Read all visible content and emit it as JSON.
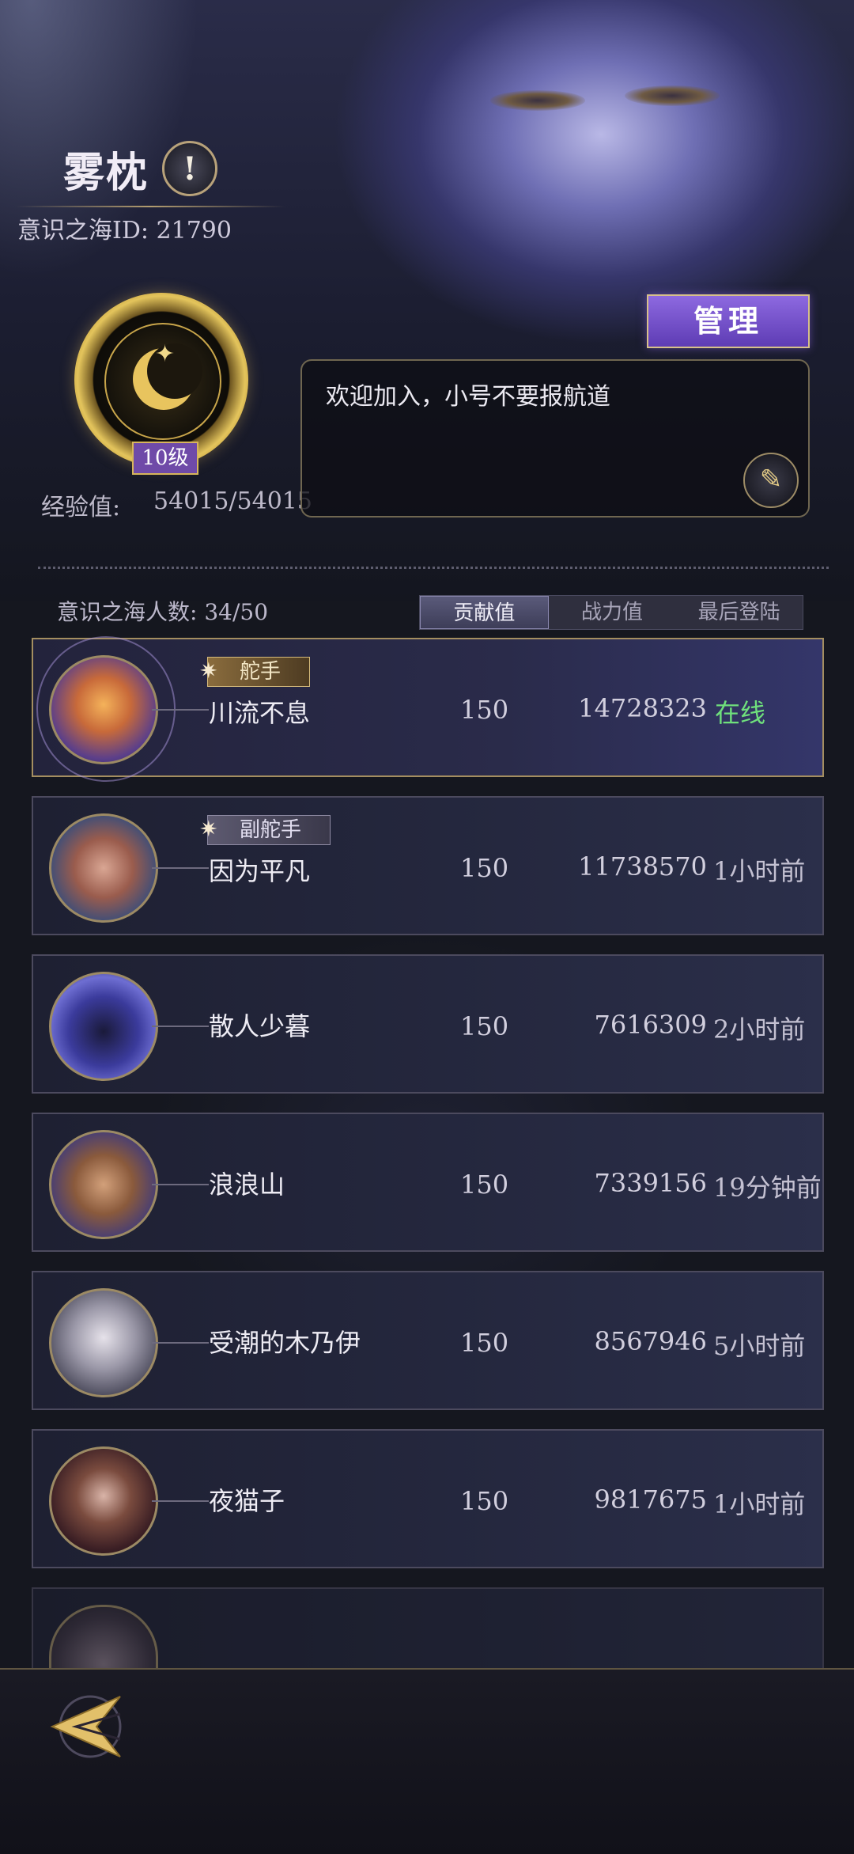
{
  "header": {
    "guild_name": "雾枕",
    "alert_icon": "!",
    "sea_id": "意识之海ID: 21790"
  },
  "badge": {
    "level": "10级",
    "exp_label": "经验值:",
    "exp_value": "54015/54015"
  },
  "manage_label": "管理",
  "notice": {
    "text": "欢迎加入，小号不要报航道"
  },
  "member_count": "意识之海人数: 34/50",
  "tabs": [
    {
      "label": "贡献值",
      "active": true
    },
    {
      "label": "战力值",
      "active": false
    },
    {
      "label": "最后登陆",
      "active": false
    }
  ],
  "members": [
    {
      "role": "舵手",
      "name": "川流不息",
      "contribution": "150",
      "power": "14728323",
      "last_login": "在线",
      "online": true
    },
    {
      "role": "副舵手",
      "name": "因为平凡",
      "contribution": "150",
      "power": "11738570",
      "last_login": "1小时前",
      "online": false
    },
    {
      "role": "",
      "name": "散人少暮",
      "contribution": "150",
      "power": "7616309",
      "last_login": "2小时前",
      "online": false
    },
    {
      "role": "",
      "name": "浪浪山",
      "contribution": "150",
      "power": "7339156",
      "last_login": "19分钟前",
      "online": false
    },
    {
      "role": "",
      "name": "受潮的木乃伊",
      "contribution": "150",
      "power": "8567946",
      "last_login": "5小时前",
      "online": false
    },
    {
      "role": "",
      "name": "夜猫子",
      "contribution": "150",
      "power": "9817675",
      "last_login": "1小时前",
      "online": false
    }
  ],
  "colors": {
    "accent_gold": "#d7b55b",
    "manage_purple": "#6f4aa8",
    "online_green": "#6fe07c"
  },
  "icons": {
    "alert": "exclamation-icon",
    "edit": "quill-icon",
    "back": "back-arrow-icon"
  }
}
